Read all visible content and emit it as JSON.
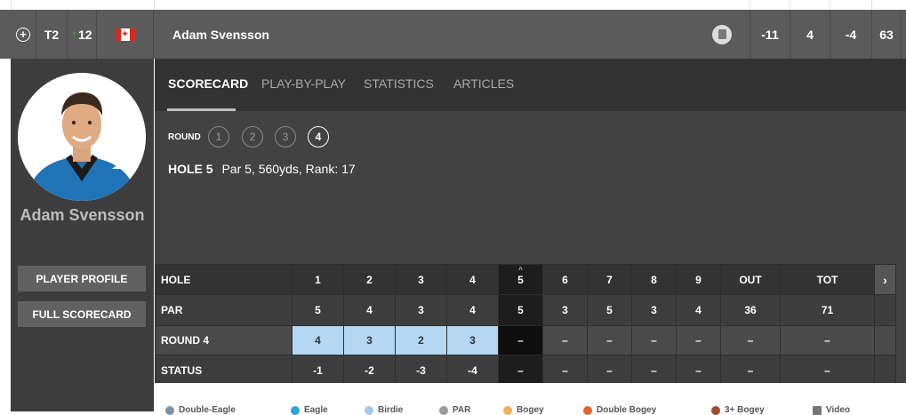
{
  "player_row": {
    "position": "T2",
    "movement": "12",
    "player_name": "Adam Svensson",
    "to_par": "-11",
    "thru": "4",
    "today": "-4",
    "r1": "63"
  },
  "profile": {
    "name": "Adam Svensson",
    "buttons": {
      "player_profile": "PLAYER PROFILE",
      "full_scorecard": "FULL SCORECARD"
    }
  },
  "tabs": [
    "SCORECARD",
    "PLAY-BY-PLAY",
    "STATISTICS",
    "ARTICLES"
  ],
  "round_selector": {
    "label": "ROUND",
    "rounds": [
      "1",
      "2",
      "3",
      "4"
    ],
    "selected": "4"
  },
  "hole_info": {
    "hole": "HOLE 5",
    "details": "Par 5, 560yds, Rank: 17"
  },
  "scorecard": {
    "rows": {
      "hole": {
        "label": "HOLE",
        "values": [
          "1",
          "2",
          "3",
          "4",
          "5",
          "6",
          "7",
          "8",
          "9",
          "OUT",
          "TOT"
        ]
      },
      "par": {
        "label": "PAR",
        "values": [
          "5",
          "4",
          "3",
          "4",
          "5",
          "3",
          "5",
          "3",
          "4",
          "36",
          "71"
        ]
      },
      "round": {
        "label": "ROUND 4",
        "values": [
          "4",
          "3",
          "2",
          "3",
          "–",
          "–",
          "–",
          "–",
          "–",
          "–",
          "–"
        ]
      },
      "status": {
        "label": "STATUS",
        "values": [
          "-1",
          "-2",
          "-3",
          "-4",
          "–",
          "–",
          "–",
          "–",
          "–",
          "–",
          "–"
        ]
      }
    }
  },
  "legend": [
    {
      "label": "Double-Eagle",
      "color": "#7b94a8"
    },
    {
      "label": "Eagle",
      "color": "#2ba3d6"
    },
    {
      "label": "Birdie",
      "color": "#a8c8e8"
    },
    {
      "label": "PAR",
      "color": "#9a9a9a"
    },
    {
      "label": "Bogey",
      "color": "#f0b15a"
    },
    {
      "label": "Double Bogey",
      "color": "#e8632b"
    },
    {
      "label": "3+ Bogey",
      "color": "#9e4a2e"
    },
    {
      "label": "Video",
      "color": "#777777"
    }
  ],
  "colors": {
    "birdie_cell": "#b4d7f4",
    "header_bg": "#5b5b5b",
    "panel_bg": "#424242"
  }
}
